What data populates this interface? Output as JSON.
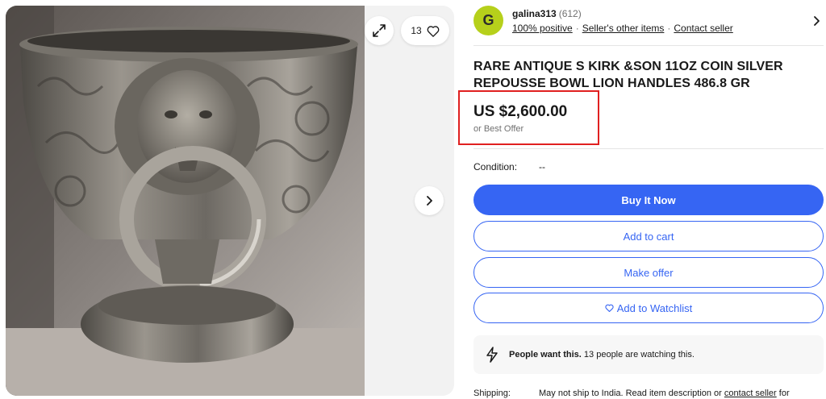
{
  "seller": {
    "avatar_letter": "G",
    "name": "galina313",
    "feedback_count": "(612)",
    "positive": "100% positive",
    "other_items": "Seller's other items",
    "contact": "Contact seller"
  },
  "gallery": {
    "watch_count": "13",
    "icons": [
      "expand-icon",
      "heart-icon",
      "chevron-right-icon"
    ]
  },
  "listing": {
    "title": "RARE ANTIQUE S KIRK &SON 11OZ COIN SILVER REPOUSSE BOWL LION HANDLES 486.8 GR",
    "price": "US $2,600.00",
    "best_offer": "or Best Offer",
    "condition_label": "Condition:",
    "condition_value": "--"
  },
  "actions": {
    "buy_now": "Buy It Now",
    "add_to_cart": "Add to cart",
    "make_offer": "Make offer",
    "add_to_watchlist": "Add to Watchlist"
  },
  "signal": {
    "strong": "People want this.",
    "text": "13 people are watching this.",
    "icon": "lightning-icon"
  },
  "shipping": {
    "label": "Shipping:",
    "text_before": "May not ship to India. Read item description or",
    "contact_link": "contact seller",
    "text_after": "for"
  },
  "colors": {
    "accent": "#3665f3",
    "avatar": "#b6d01b",
    "highlight": "#e02020"
  }
}
